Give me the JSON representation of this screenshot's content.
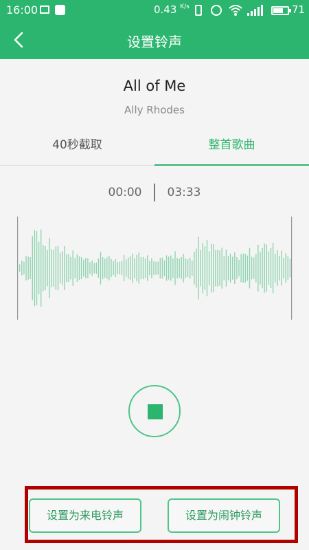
{
  "status_bar": {
    "time": "16:00",
    "net_speed": "0.43",
    "net_speed_unit": "K/s",
    "battery_level": "71",
    "battery_fraction": 0.71
  },
  "app_bar": {
    "title": "设置铃声",
    "back_icon": "chevron-left-icon"
  },
  "song": {
    "title": "All of Me",
    "artist": "Ally Rhodes"
  },
  "tabs": [
    {
      "label": "40秒截取",
      "selected": false
    },
    {
      "label": "整首歌曲",
      "selected": true
    }
  ],
  "playback": {
    "current_time": "00:00",
    "total_time": "03:33",
    "control_icon": "stop-icon"
  },
  "actions": {
    "set_call_ringtone": "设置为来电铃声",
    "set_alarm_ringtone": "设置为闹钟铃声"
  },
  "colors": {
    "accent": "#2cb56e",
    "waveform": "#8fd4b0",
    "highlight": "#b00000"
  }
}
